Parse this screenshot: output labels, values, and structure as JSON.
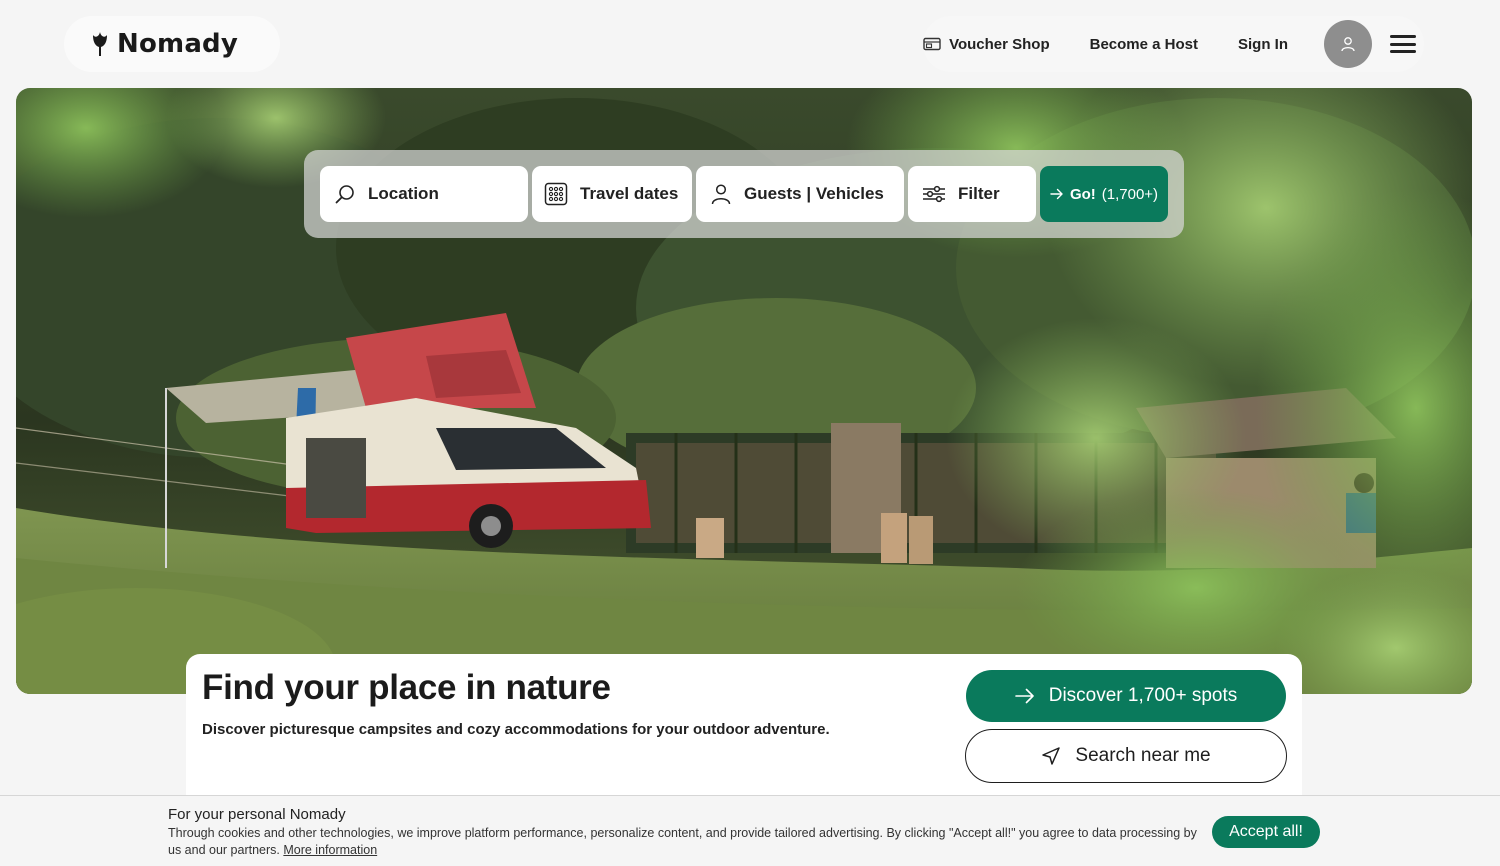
{
  "brand": {
    "name": "Nomady"
  },
  "header": {
    "voucher_shop": "Voucher Shop",
    "become_host": "Become a Host",
    "sign_in": "Sign In"
  },
  "search": {
    "location": "Location",
    "travel_dates": "Travel dates",
    "guests_vehicles": "Guests | Vehicles",
    "filter": "Filter",
    "go_label": "Go!",
    "go_count": "(1,700+)"
  },
  "hero": {
    "title": "Find your place in nature",
    "subtitle": "Discover picturesque campsites and cozy accommodations for your outdoor adventure.",
    "discover_button": "Discover 1,700+ spots",
    "near_button": "Search near me"
  },
  "cookie_banner": {
    "title": "For your personal Nomady",
    "text": "Through cookies and other technologies, we improve platform performance, personalize content, and provide tailored advertising. By clicking \"Accept all!\" you agree to data processing by us and our partners.",
    "more_info": "More information",
    "accept": "Accept all!"
  },
  "colors": {
    "accent": "#0a7a5c",
    "background": "#f5f5f5"
  },
  "icons": [
    "flame-logo-icon",
    "voucher-icon",
    "user-icon",
    "menu-icon",
    "search-icon",
    "calendar-icon",
    "person-icon",
    "filter-icon",
    "arrow-right-icon",
    "navigation-icon"
  ]
}
